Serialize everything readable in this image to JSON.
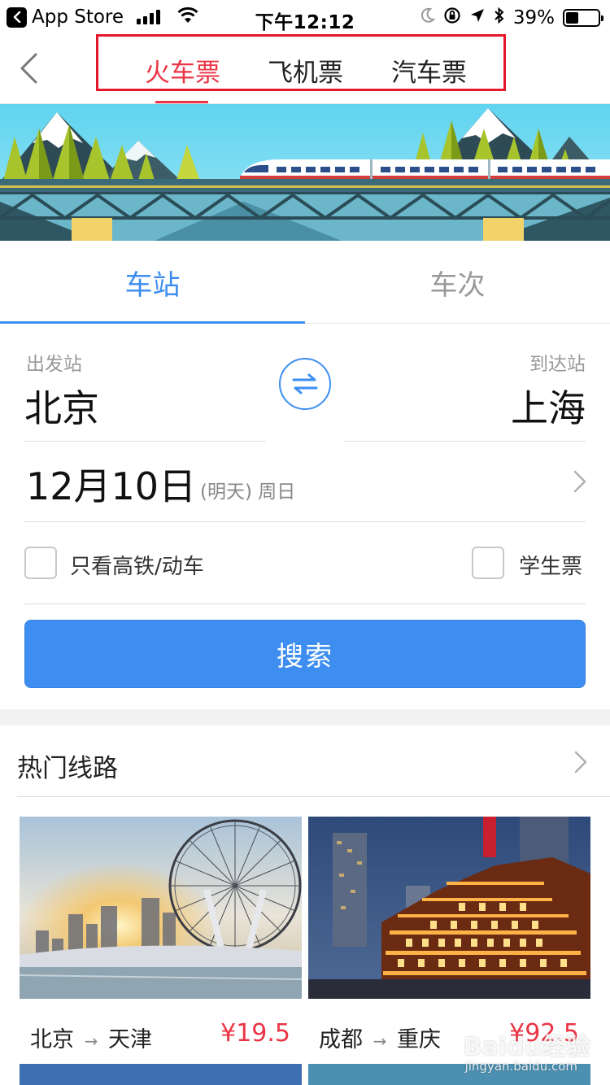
{
  "status_bar": {
    "back_app": "App Store",
    "time": "下午12:12",
    "battery": "39%",
    "battery_level": 0.39
  },
  "nav": {
    "tabs": [
      {
        "label": "火车票",
        "active": true
      },
      {
        "label": "飞机票",
        "active": false
      },
      {
        "label": "汽车票",
        "active": false
      }
    ]
  },
  "segment": {
    "tabs": [
      {
        "label": "车站",
        "active": true
      },
      {
        "label": "车次",
        "active": false
      }
    ]
  },
  "form": {
    "from_label": "出发站",
    "from_city": "北京",
    "to_label": "到达站",
    "to_city": "上海",
    "date": "12月10日",
    "date_note": "(明天) 周日",
    "option_high_speed": "只看高铁/动车",
    "option_student": "学生票",
    "search_label": "搜索"
  },
  "hot_routes": {
    "title": "热门线路",
    "routes": [
      {
        "from": "北京",
        "to": "天津",
        "price": "¥19.5"
      },
      {
        "from": "成都",
        "to": "重庆",
        "price": "¥92.5"
      }
    ]
  },
  "watermark": {
    "text": "Baidu经验",
    "url": "jingyan.baidu.com"
  },
  "colors": {
    "accent_blue": "#3d8ef0",
    "accent_red": "#e93545",
    "highlight_box": "#e5172a"
  }
}
